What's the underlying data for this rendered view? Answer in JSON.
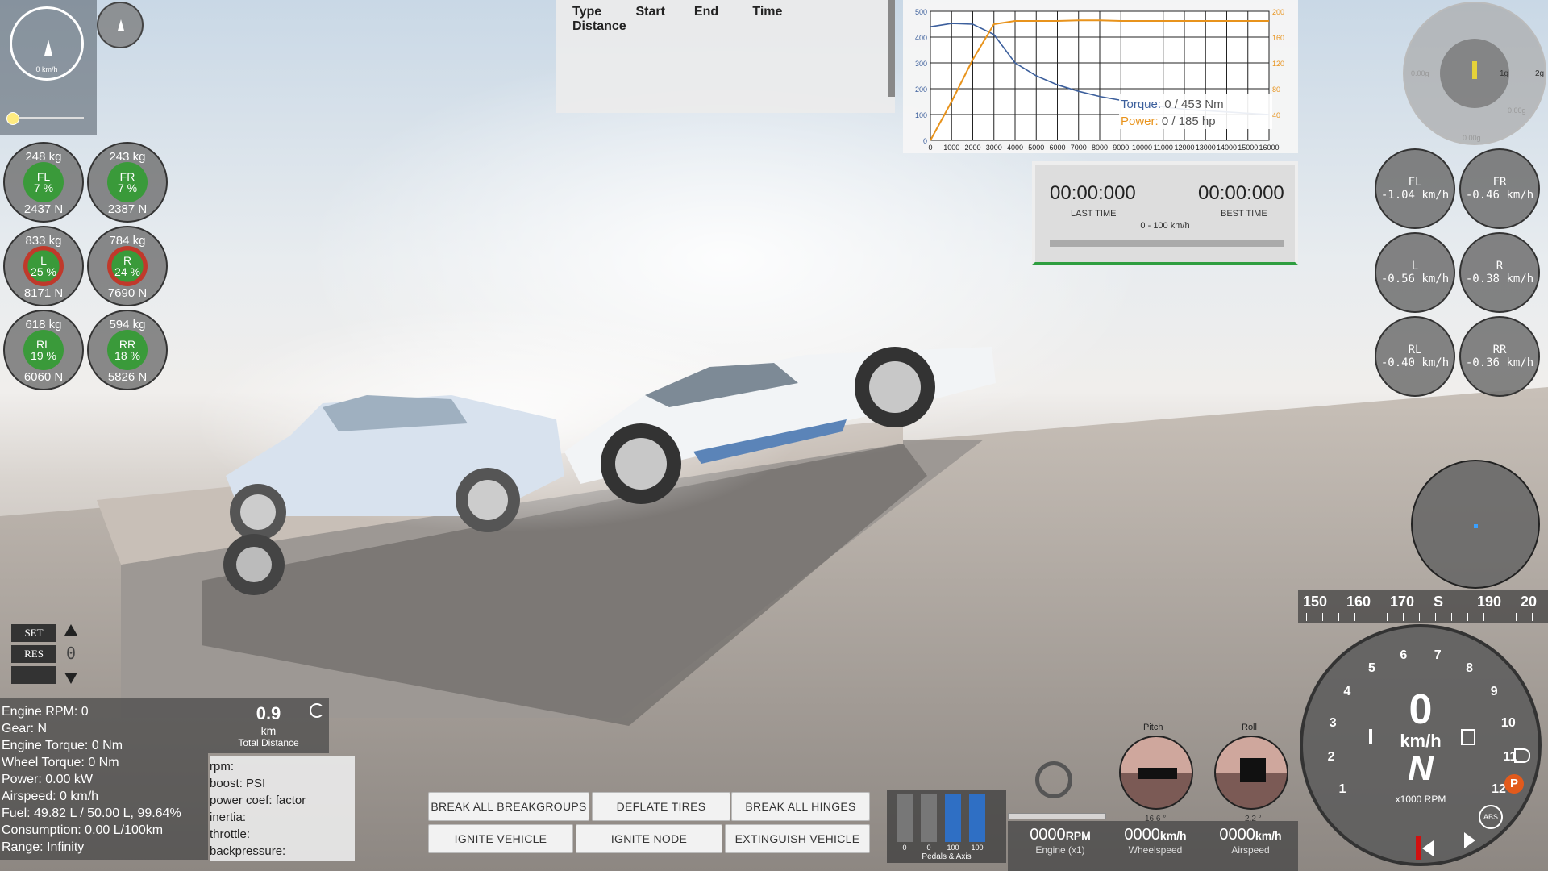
{
  "minimap": {
    "speed": "0 km/h"
  },
  "wheels_load": [
    {
      "name": "FL",
      "kg": "248 kg",
      "pct": "7 %",
      "n": "2437 N",
      "ring": "green"
    },
    {
      "name": "FR",
      "kg": "243 kg",
      "pct": "7 %",
      "n": "2387 N",
      "ring": "green"
    },
    {
      "name": "L",
      "kg": "833 kg",
      "pct": "25 %",
      "n": "8171 N",
      "ring": "red"
    },
    {
      "name": "R",
      "kg": "784 kg",
      "pct": "24 %",
      "n": "7690 N",
      "ring": "red"
    },
    {
      "name": "RL",
      "kg": "618 kg",
      "pct": "19 %",
      "n": "6060 N",
      "ring": "green"
    },
    {
      "name": "RR",
      "kg": "594 kg",
      "pct": "18 %",
      "n": "5826 N",
      "ring": "green"
    }
  ],
  "wheel_speeds": [
    {
      "name": "FL",
      "val": "-1.04 km/h"
    },
    {
      "name": "FR",
      "val": "-0.46 km/h"
    },
    {
      "name": "L",
      "val": "-0.56 km/h"
    },
    {
      "name": "R",
      "val": "-0.38 km/h"
    },
    {
      "name": "RL",
      "val": "-0.40 km/h"
    },
    {
      "name": "RR",
      "val": "-0.36 km/h"
    }
  ],
  "drag_table": {
    "headers": [
      "Type",
      "Start",
      "End",
      "Time",
      "Distance"
    ]
  },
  "torque_chart": {
    "left_ticks": [
      "500",
      "400",
      "300",
      "200",
      "100",
      "0"
    ],
    "right_ticks": [
      "200",
      "160",
      "120",
      "80",
      "40"
    ],
    "x_ticks": [
      "0",
      "1000",
      "2000",
      "3000",
      "4000",
      "5000",
      "6000",
      "7000",
      "8000",
      "9000",
      "10000",
      "11000",
      "12000",
      "13000",
      "14000",
      "15000",
      "16000"
    ],
    "torque_label": "Torque:",
    "torque_val": " 0 / 453 Nm",
    "power_label": "Power:",
    "power_val": " 0 / 185 hp",
    "colors": {
      "torque": "#3c5f9c",
      "power": "#e8931c"
    }
  },
  "chart_data": {
    "type": "line",
    "x": [
      0,
      1000,
      2000,
      3000,
      4000,
      5000,
      6000,
      7000,
      8000,
      9000,
      10000,
      11000,
      12000,
      13000,
      14000,
      15000,
      16000
    ],
    "series": [
      {
        "name": "Torque",
        "values": [
          440,
          453,
          450,
          410,
          300,
          250,
          215,
          190,
          170,
          155,
          140,
          130,
          120,
          115,
          110,
          105,
          100
        ]
      },
      {
        "name": "Power",
        "values": [
          0,
          60,
          125,
          180,
          185,
          185,
          185,
          186,
          186,
          185,
          185,
          185,
          185,
          185,
          185,
          185,
          185
        ]
      }
    ],
    "xlim": [
      0,
      16000
    ],
    "ylim_left": [
      0,
      500
    ],
    "ylim_right": [
      0,
      200
    ]
  },
  "timer": {
    "last": "00:00:000",
    "best": "00:00:000",
    "last_label": "LAST TIME",
    "best_label": "BEST TIME",
    "mode": "0 - 100 km/h"
  },
  "gforce": {
    "g1": "1g",
    "g2": "2g",
    "l1": "0.00g",
    "r1": "0.00g",
    "b1": "0.00g"
  },
  "compass_strip": [
    "150",
    "160",
    "170",
    "S",
    "190",
    "20"
  ],
  "cruise": {
    "set": "SET",
    "res": "RES",
    "val": "0"
  },
  "engine_info": [
    "Engine RPM: 0",
    "Gear: N",
    "Engine Torque: 0 Nm",
    "Wheel Torque: 0 Nm",
    "Power: 0.00 kW",
    "Airspeed: 0 km/h",
    "Fuel: 49.82 L / 50.00 L, 99.64%",
    "Consumption: 0.00 L/100km",
    "Range: Infinity"
  ],
  "trip": {
    "value": "0.9",
    "unit": "km",
    "label": "Total Distance"
  },
  "turbo": [
    "rpm:",
    "boost: PSI",
    "power coef: factor",
    "inertia:",
    "throttle:",
    "backpressure:"
  ],
  "buttons": {
    "break_groups": "BREAK ALL BREAKGROUPS",
    "deflate": "DEFLATE TIRES",
    "break_hinges": "BREAK ALL HINGES",
    "ignite_vehicle": "IGNITE VEHICLE",
    "ignite_node": "IGNITE NODE",
    "extinguish": "EXTINGUISH VEHICLE"
  },
  "pedals": {
    "values": [
      "0",
      "0",
      "100",
      "100"
    ],
    "label": "Pedals & Axis",
    "fills": [
      0,
      0,
      1,
      1
    ]
  },
  "readouts": [
    {
      "val": "0000",
      "unit": "RPM",
      "label": "Engine (x1)"
    },
    {
      "val": "0000",
      "unit": "km/h",
      "label": "Wheelspeed"
    },
    {
      "val": "0000",
      "unit": "km/h",
      "label": "Airspeed"
    }
  ],
  "attitude": {
    "pitch_label": "Pitch",
    "pitch_val": "16.6 °",
    "roll_label": "Roll",
    "roll_val": "2.2 °"
  },
  "speedo": {
    "speed": "0",
    "unit": "km/h",
    "gear": "N",
    "rpm_label": "x1000 RPM",
    "ticks": [
      "1",
      "2",
      "3",
      "4",
      "5",
      "6",
      "7",
      "8",
      "9",
      "10",
      "11",
      "12"
    ],
    "abs": "ABS",
    "park": "P"
  }
}
